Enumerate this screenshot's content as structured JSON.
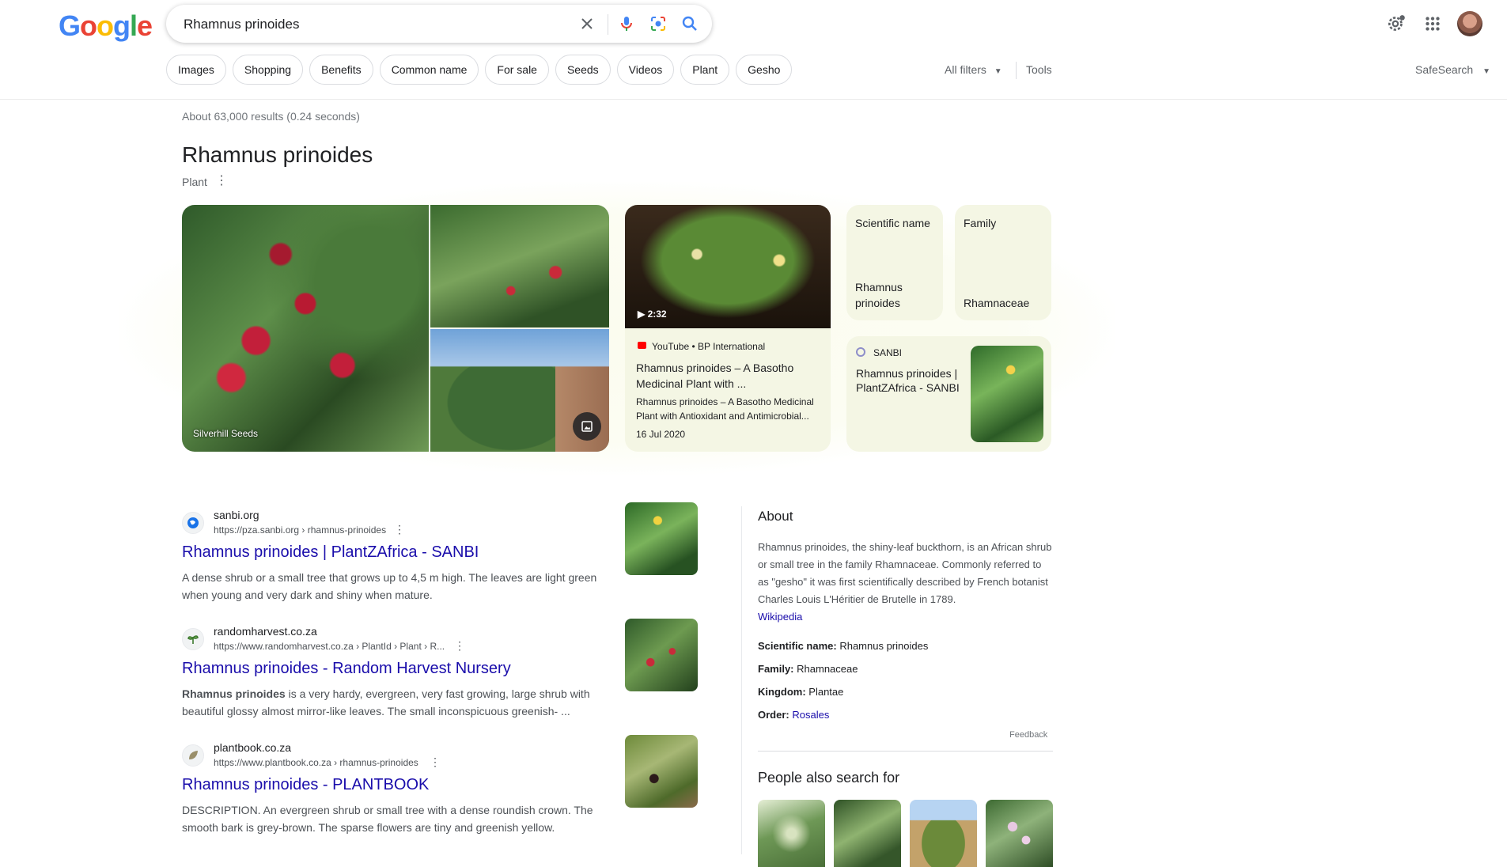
{
  "logo_letters": [
    "G",
    "o",
    "o",
    "g",
    "l",
    "e"
  ],
  "search": {
    "query": "Rhamnus prinoides"
  },
  "chips": [
    "Images",
    "Shopping",
    "Benefits",
    "Common name",
    "For sale",
    "Seeds",
    "Videos",
    "Plant",
    "Gesho"
  ],
  "filters": {
    "all_filters": "All filters",
    "tools": "Tools",
    "safesearch": "SafeSearch"
  },
  "result_stats": "About 63,000 results (0.24 seconds)",
  "knowledge": {
    "title": "Rhamnus prinoides",
    "subtitle": "Plant",
    "collage_credit": "Silverhill Seeds",
    "video": {
      "duration": "2:32",
      "source": "YouTube • BP International",
      "title": "Rhamnus prinoides – A Basotho Medicinal Plant with ...",
      "description": "Rhamnus prinoides – A Basotho Medicinal Plant with Antioxidant and Antimicrobial...",
      "date": "16 Jul 2020"
    },
    "tiles": [
      {
        "label": "Scientific name",
        "value": "Rhamnus prinoides"
      },
      {
        "label": "Family",
        "value": "Rhamnaceae"
      }
    ],
    "sanbi": {
      "source": "SANBI",
      "title": "Rhamnus prinoides | PlantZAfrica - SANBI"
    }
  },
  "results": [
    {
      "site": "sanbi.org",
      "url": "https://pza.sanbi.org › rhamnus-prinoides",
      "title": "Rhamnus prinoides | PlantZAfrica - SANBI",
      "snippet_bold": "",
      "snippet": "A dense shrub or a small tree that grows up to 4,5 m high. The leaves are light green when young and very dark and shiny when mature."
    },
    {
      "site": "randomharvest.co.za",
      "url": "https://www.randomharvest.co.za › PlantId › Plant › R...",
      "title": "Rhamnus prinoides - Random Harvest Nursery",
      "snippet_bold": "Rhamnus prinoides",
      "snippet": " is a very hardy, evergreen, very fast growing, large shrub with beautiful glossy almost mirror-like leaves. The small inconspicuous greenish- ..."
    },
    {
      "site": "plantbook.co.za",
      "url": "https://www.plantbook.co.za › rhamnus-prinoides",
      "title": "Rhamnus prinoides - PLANTBOOK",
      "snippet_bold": "",
      "snippet": "DESCRIPTION. An evergreen shrub or small tree with a dense roundish crown. The smooth bark is grey-brown. The sparse flowers are tiny and greenish yellow."
    }
  ],
  "about": {
    "title": "About",
    "text": "Rhamnus prinoides, the shiny-leaf buckthorn, is an African shrub or small tree in the family Rhamnaceae. Commonly referred to as \"gesho\" it was first scientifically described by French botanist Charles Louis L'Héritier de Brutelle in 1789.",
    "wiki": "Wikipedia",
    "facts": [
      {
        "label": "Scientific name:",
        "value": "Rhamnus prinoides"
      },
      {
        "label": "Family:",
        "value": "Rhamnaceae"
      },
      {
        "label": "Kingdom:",
        "value": "Plantae"
      },
      {
        "label": "Order:",
        "value": "Rosales"
      }
    ],
    "feedback": "Feedback",
    "people_also_search": "People also search for"
  }
}
